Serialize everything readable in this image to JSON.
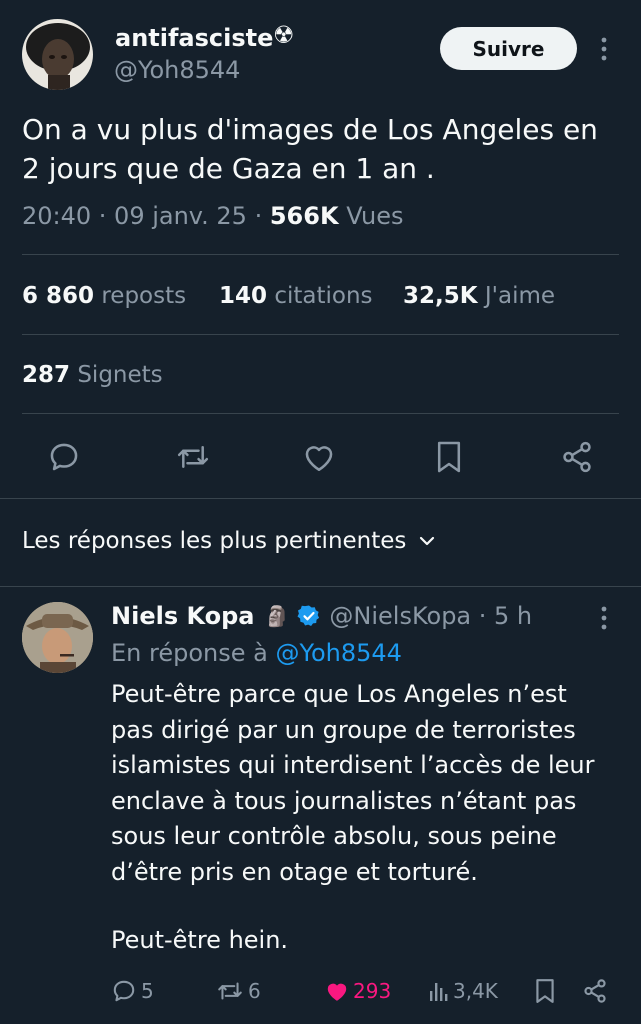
{
  "tweet": {
    "author_name": "antifasciste",
    "author_badge": "☢",
    "handle": "@Yoh8544",
    "follow_label": "Suivre",
    "text_line1": "On a vu plus d'images de Los Angeles en",
    "text_line2": "2 jours que de Gaza en 1 an .",
    "time": "20:40 · 09 janv. 25 ·",
    "views_count": "566K",
    "views_label": "Vues",
    "stats": {
      "reposts_count": "6 860",
      "reposts_label": "reposts",
      "quotes_count": "140",
      "quotes_label": "citations",
      "likes_count": "32,5K",
      "likes_label": "J'aime",
      "bookmarks_count": "287",
      "bookmarks_label": "Signets"
    }
  },
  "replies_header": {
    "label": "Les réponses les plus pertinentes"
  },
  "reply": {
    "author_name": "Niels Kopa",
    "emoji": "🗿",
    "handle_time": "@NielsKopa · 5 h",
    "in_reply_prefix": "En réponse à",
    "in_reply_handle": "@Yoh8544",
    "lines": [
      "Peut-être parce que Los Angeles n’est",
      "pas dirigé par un groupe de terroristes",
      "islamistes qui interdisent l’accès de leur",
      "enclave à tous journalistes n’étant pas",
      "sous leur contrôle absolu, sous peine",
      "d’être pris en otage et torturé."
    ],
    "last_line": "Peut-être hein.",
    "actions": {
      "replies": "5",
      "reposts": "6",
      "likes": "293",
      "views": "3,4K"
    }
  },
  "colors": {
    "background": "#15202b",
    "text": "#f7f9f9",
    "muted": "#8b98a5",
    "link": "#1d9bf0",
    "like": "#f91880",
    "divider": "#38444d",
    "verified": "#1d9bf0"
  }
}
